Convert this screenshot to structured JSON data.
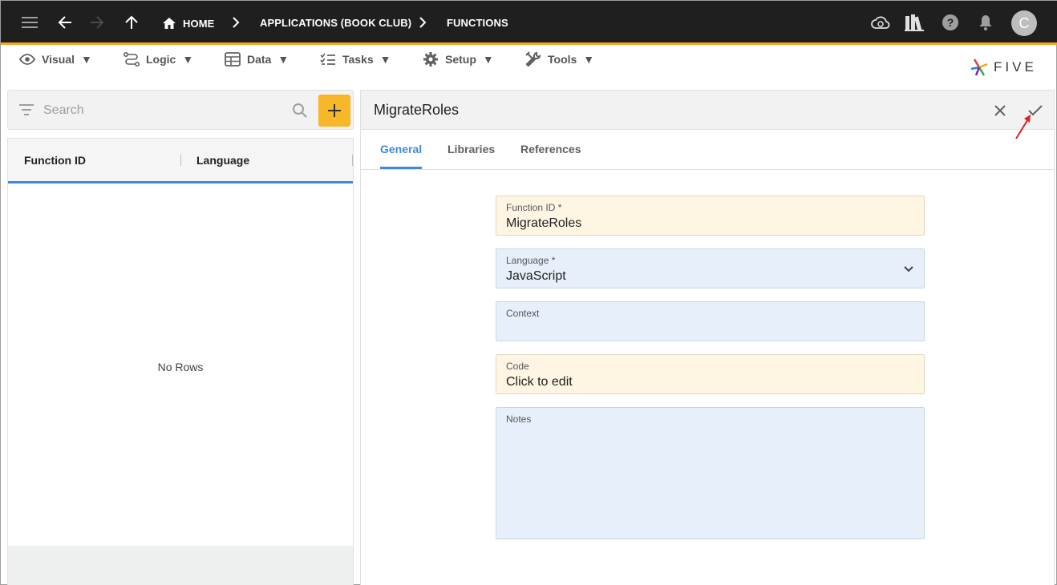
{
  "topbar": {
    "breadcrumbs": [
      {
        "label": "HOME"
      },
      {
        "label": "APPLICATIONS (BOOK CLUB)"
      },
      {
        "label": "FUNCTIONS"
      }
    ],
    "avatar_initial": "C"
  },
  "menu": {
    "items": [
      {
        "label": "Visual",
        "icon": "eye-icon"
      },
      {
        "label": "Logic",
        "icon": "logic-icon"
      },
      {
        "label": "Data",
        "icon": "table-icon"
      },
      {
        "label": "Tasks",
        "icon": "tasks-icon"
      },
      {
        "label": "Setup",
        "icon": "gear-icon"
      },
      {
        "label": "Tools",
        "icon": "tools-icon"
      }
    ],
    "dropdown_glyph": "▼"
  },
  "brand": {
    "logo_text": "FIVE"
  },
  "list": {
    "search_placeholder": "Search",
    "columns": [
      "Function ID",
      "Language"
    ],
    "empty_text": "No Rows"
  },
  "form": {
    "title": "MigrateRoles",
    "tabs": [
      "General",
      "Libraries",
      "References"
    ],
    "active_tab": "General",
    "fields": {
      "function_id": {
        "label": "Function ID *",
        "value": "MigrateRoles"
      },
      "language": {
        "label": "Language *",
        "value": "JavaScript"
      },
      "context": {
        "label": "Context",
        "value": ""
      },
      "code": {
        "label": "Code",
        "value": "Click to edit"
      },
      "notes": {
        "label": "Notes",
        "value": ""
      }
    }
  },
  "colors": {
    "accent": "#f5a623",
    "tab_active": "#3f8ad8",
    "required_field_bg": "#fff5e3",
    "field_bg": "#e7f0fa",
    "annotation_arrow": "#e02020"
  }
}
